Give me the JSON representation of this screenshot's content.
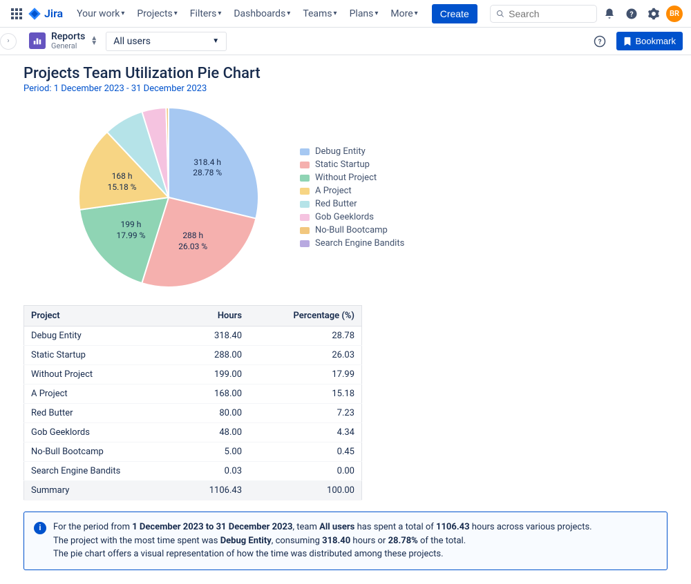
{
  "nav": {
    "product": "Jira",
    "items": [
      "Your work",
      "Projects",
      "Filters",
      "Dashboards",
      "Teams",
      "Plans",
      "More"
    ],
    "create": "Create",
    "search_placeholder": "Search",
    "avatar_initials": "BR"
  },
  "secondary": {
    "report_label": "Reports",
    "report_sub": "General",
    "user_select": "All users",
    "bookmark": "Bookmark"
  },
  "page": {
    "title": "Projects Team Utilization Pie Chart",
    "period": "Period: 1 December 2023 - 31 December 2023"
  },
  "chart_data": {
    "type": "pie",
    "title": "Projects Team Utilization Pie Chart",
    "series": [
      {
        "name": "Debug Entity",
        "hours": 318.4,
        "percent": 28.78,
        "color": "#A6C8F2",
        "label": "318.4 h\n28.78 %"
      },
      {
        "name": "Static Startup",
        "hours": 288.0,
        "percent": 26.03,
        "color": "#F5B0AE",
        "label": "288 h\n26.03 %"
      },
      {
        "name": "Without Project",
        "hours": 199.0,
        "percent": 17.99,
        "color": "#8FD4B4",
        "label": "199 h\n17.99 %"
      },
      {
        "name": "A Project",
        "hours": 168.0,
        "percent": 15.18,
        "color": "#F7D584",
        "label": "168 h\n15.18 %"
      },
      {
        "name": "Red Butter",
        "hours": 80.0,
        "percent": 7.23,
        "color": "#B5E3E8",
        "label": ""
      },
      {
        "name": "Gob Geeklords",
        "hours": 48.0,
        "percent": 4.34,
        "color": "#F5C3E0",
        "label": ""
      },
      {
        "name": "No-Bull Bootcamp",
        "hours": 5.0,
        "percent": 0.45,
        "color": "#F2C77E",
        "label": ""
      },
      {
        "name": "Search Engine Bandits",
        "hours": 0.03,
        "percent": 0.0,
        "color": "#B8A9E0",
        "label": ""
      }
    ]
  },
  "table": {
    "headers": [
      "Project",
      "Hours",
      "Percentage (%)"
    ],
    "rows": [
      [
        "Debug Entity",
        "318.40",
        "28.78"
      ],
      [
        "Static Startup",
        "288.00",
        "26.03"
      ],
      [
        "Without Project",
        "199.00",
        "17.99"
      ],
      [
        "A Project",
        "168.00",
        "15.18"
      ],
      [
        "Red Butter",
        "80.00",
        "7.23"
      ],
      [
        "Gob Geeklords",
        "48.00",
        "4.34"
      ],
      [
        "No-Bull Bootcamp",
        "5.00",
        "0.45"
      ],
      [
        "Search Engine Bandits",
        "0.03",
        "0.00"
      ]
    ],
    "summary": [
      "Summary",
      "1106.43",
      "100.00"
    ]
  },
  "info": {
    "l1a": "For the period from ",
    "l1b": "1 December 2023 to 31 December 2023",
    "l1c": ", team ",
    "l1d": "All users",
    "l1e": " has spent a total of ",
    "l1f": "1106.43",
    "l1g": " hours across various projects.",
    "l2a": "The project with the most time spent was ",
    "l2b": "Debug Entity",
    "l2c": ", consuming ",
    "l2d": "318.40",
    "l2e": " hours or ",
    "l2f": "28.78%",
    "l2g": " of the total.",
    "l3": "The pie chart offers a visual representation of how the time was distributed among these projects."
  }
}
